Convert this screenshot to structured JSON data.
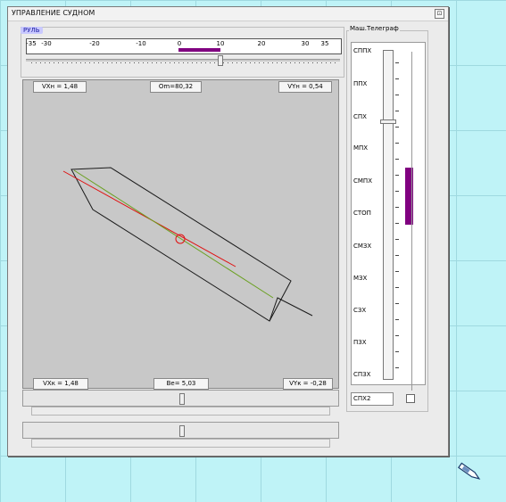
{
  "window": {
    "title": "УПРАВЛЕНИЕ СУДНОМ",
    "close_label": "⊡"
  },
  "rudder": {
    "caption": "РУЛЬ",
    "ticks": [
      "-35",
      "-30",
      "-20",
      "-10",
      "0",
      "10",
      "20",
      "30",
      "35"
    ],
    "angle_range": [
      -35,
      35
    ],
    "indicator_range": [
      0,
      10
    ],
    "slider_value": 10
  },
  "readouts": {
    "vxn": "VXн = 1,48",
    "om": "Om=80,32",
    "vyn": "VYн = 0,54",
    "vxk": "VXк = 1,48",
    "be": "Be= 5,03",
    "vyk": "VYк = -0,28"
  },
  "telegraph": {
    "caption": "Маш.Телеграф",
    "labels": [
      "СППХ",
      "ППХ",
      "СПХ",
      "МПХ",
      "СМПХ",
      "СТОП",
      "СМЗХ",
      "МЗХ",
      "СЗХ",
      "ПЗХ",
      "СПЗХ"
    ],
    "selected": "СПХ2",
    "checkbox_checked": false
  },
  "colors": {
    "indicator": "#800080",
    "heading_line": "#e01010",
    "course_line": "#6aa020"
  }
}
